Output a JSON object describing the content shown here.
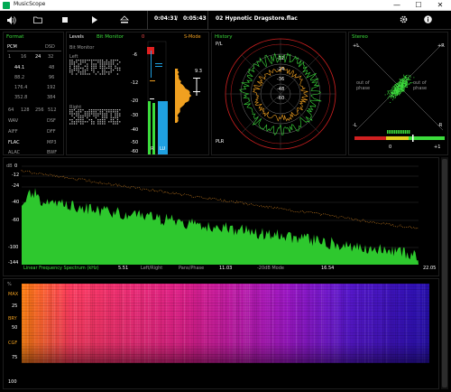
{
  "window": {
    "title": "MusicScope",
    "minimize": "—",
    "maximize": "☐",
    "close": "✕"
  },
  "toolbar": {
    "volume_icon": "🔊",
    "folder_icon": "📁",
    "stop_icon": "■",
    "play_icon": "▶",
    "eject_icon": "⏏",
    "current_time": "0:04:31",
    "separator": "/",
    "total_time": "0:05:43",
    "track_name": "02 Hypnotic Dragstore.flac",
    "settings_icon": "⚙",
    "info_icon": "ℹ"
  },
  "format_panel": {
    "title": "Format",
    "pcm": "PCM",
    "dsd": "DSD",
    "bits": [
      "1",
      "16",
      "24",
      "32"
    ],
    "rates_left": [
      "44.1",
      "88.2",
      "176.4",
      "352.8"
    ],
    "rates_right": [
      "48",
      "96",
      "192",
      "384"
    ],
    "dsd_rates": [
      "64",
      "128",
      "256",
      "512"
    ],
    "containers_left": [
      "WAV",
      "AIFF",
      "FLAC",
      "ALAC"
    ],
    "containers_right": [
      "DSF",
      "DFF",
      "MP3",
      "BWF"
    ]
  },
  "levels_panel": {
    "title": "Levels",
    "bit_monitor": "Bit Monitor",
    "bit_monitor_sub": "Bit Monitor",
    "left": "Left",
    "right": "Right",
    "zero": "0",
    "s_mode": "S-Mode",
    "peak_value": "9.3",
    "scale": [
      "-6",
      "-12",
      "-20",
      "-30",
      "-40",
      "-50",
      "-60"
    ],
    "meter_labels": [
      "R",
      "LU"
    ]
  },
  "history_panel": {
    "title": "History",
    "pl_label": "P/L",
    "plr_label": "PLR",
    "rings": [
      "-12",
      "-24",
      "-36",
      "-48",
      "-60"
    ]
  },
  "stereo_panel": {
    "title": "Stereo",
    "plus_l": "+L",
    "plus_r": "+R",
    "minus_l": "-L",
    "minus_r": "-R",
    "out_left": "out of phase",
    "out_right": "out of phase",
    "corr_low": "0",
    "corr_high": "+1"
  },
  "spectrum": {
    "db_label": "dB",
    "y_ticks": [
      "0",
      "-12",
      "-24",
      "-40",
      "-60",
      "-100",
      "-144"
    ],
    "x_ticks": [
      "5.51",
      "11.03",
      "16.54",
      "22.05"
    ],
    "footer": {
      "spectrum_type": "Linear Frequency Spectrum (kHz)",
      "left_right": "Left/Right",
      "pans": "Pans/Phase",
      "mode": "-20dB Mode"
    }
  },
  "spectrogram": {
    "pct_label": "%",
    "y_ticks": [
      "25",
      "50",
      "75",
      "100"
    ],
    "markers": [
      "MAX",
      "BRY",
      "CGF"
    ]
  },
  "colors": {
    "accent_green": "#3cdc3c",
    "orange": "#f0a020",
    "red": "#e02020",
    "blue_meter": "#1fa0e0"
  }
}
